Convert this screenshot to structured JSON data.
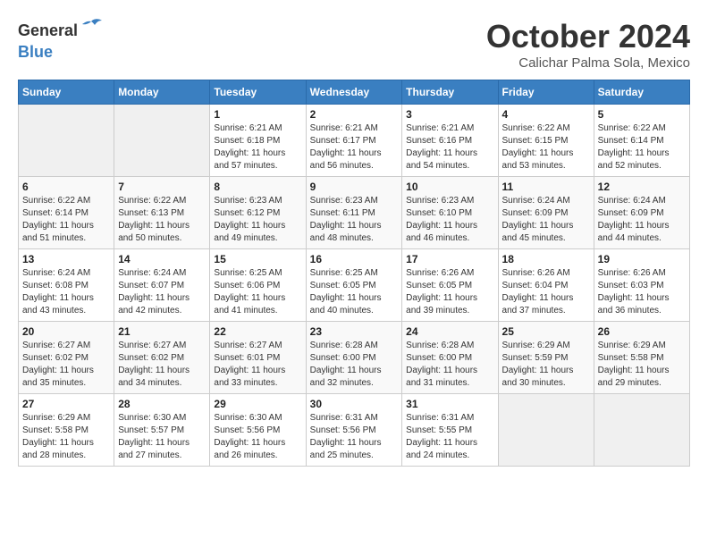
{
  "header": {
    "logo": {
      "general": "General",
      "blue": "Blue",
      "bird_symbol": "▶"
    },
    "month_title": "October 2024",
    "location": "Calichar Palma Sola, Mexico"
  },
  "calendar": {
    "weekdays": [
      "Sunday",
      "Monday",
      "Tuesday",
      "Wednesday",
      "Thursday",
      "Friday",
      "Saturday"
    ],
    "weeks": [
      [
        {
          "day": "",
          "info": ""
        },
        {
          "day": "",
          "info": ""
        },
        {
          "day": "1",
          "info": "Sunrise: 6:21 AM\nSunset: 6:18 PM\nDaylight: 11 hours and 57 minutes."
        },
        {
          "day": "2",
          "info": "Sunrise: 6:21 AM\nSunset: 6:17 PM\nDaylight: 11 hours and 56 minutes."
        },
        {
          "day": "3",
          "info": "Sunrise: 6:21 AM\nSunset: 6:16 PM\nDaylight: 11 hours and 54 minutes."
        },
        {
          "day": "4",
          "info": "Sunrise: 6:22 AM\nSunset: 6:15 PM\nDaylight: 11 hours and 53 minutes."
        },
        {
          "day": "5",
          "info": "Sunrise: 6:22 AM\nSunset: 6:14 PM\nDaylight: 11 hours and 52 minutes."
        }
      ],
      [
        {
          "day": "6",
          "info": "Sunrise: 6:22 AM\nSunset: 6:14 PM\nDaylight: 11 hours and 51 minutes."
        },
        {
          "day": "7",
          "info": "Sunrise: 6:22 AM\nSunset: 6:13 PM\nDaylight: 11 hours and 50 minutes."
        },
        {
          "day": "8",
          "info": "Sunrise: 6:23 AM\nSunset: 6:12 PM\nDaylight: 11 hours and 49 minutes."
        },
        {
          "day": "9",
          "info": "Sunrise: 6:23 AM\nSunset: 6:11 PM\nDaylight: 11 hours and 48 minutes."
        },
        {
          "day": "10",
          "info": "Sunrise: 6:23 AM\nSunset: 6:10 PM\nDaylight: 11 hours and 46 minutes."
        },
        {
          "day": "11",
          "info": "Sunrise: 6:24 AM\nSunset: 6:09 PM\nDaylight: 11 hours and 45 minutes."
        },
        {
          "day": "12",
          "info": "Sunrise: 6:24 AM\nSunset: 6:09 PM\nDaylight: 11 hours and 44 minutes."
        }
      ],
      [
        {
          "day": "13",
          "info": "Sunrise: 6:24 AM\nSunset: 6:08 PM\nDaylight: 11 hours and 43 minutes."
        },
        {
          "day": "14",
          "info": "Sunrise: 6:24 AM\nSunset: 6:07 PM\nDaylight: 11 hours and 42 minutes."
        },
        {
          "day": "15",
          "info": "Sunrise: 6:25 AM\nSunset: 6:06 PM\nDaylight: 11 hours and 41 minutes."
        },
        {
          "day": "16",
          "info": "Sunrise: 6:25 AM\nSunset: 6:05 PM\nDaylight: 11 hours and 40 minutes."
        },
        {
          "day": "17",
          "info": "Sunrise: 6:26 AM\nSunset: 6:05 PM\nDaylight: 11 hours and 39 minutes."
        },
        {
          "day": "18",
          "info": "Sunrise: 6:26 AM\nSunset: 6:04 PM\nDaylight: 11 hours and 37 minutes."
        },
        {
          "day": "19",
          "info": "Sunrise: 6:26 AM\nSunset: 6:03 PM\nDaylight: 11 hours and 36 minutes."
        }
      ],
      [
        {
          "day": "20",
          "info": "Sunrise: 6:27 AM\nSunset: 6:02 PM\nDaylight: 11 hours and 35 minutes."
        },
        {
          "day": "21",
          "info": "Sunrise: 6:27 AM\nSunset: 6:02 PM\nDaylight: 11 hours and 34 minutes."
        },
        {
          "day": "22",
          "info": "Sunrise: 6:27 AM\nSunset: 6:01 PM\nDaylight: 11 hours and 33 minutes."
        },
        {
          "day": "23",
          "info": "Sunrise: 6:28 AM\nSunset: 6:00 PM\nDaylight: 11 hours and 32 minutes."
        },
        {
          "day": "24",
          "info": "Sunrise: 6:28 AM\nSunset: 6:00 PM\nDaylight: 11 hours and 31 minutes."
        },
        {
          "day": "25",
          "info": "Sunrise: 6:29 AM\nSunset: 5:59 PM\nDaylight: 11 hours and 30 minutes."
        },
        {
          "day": "26",
          "info": "Sunrise: 6:29 AM\nSunset: 5:58 PM\nDaylight: 11 hours and 29 minutes."
        }
      ],
      [
        {
          "day": "27",
          "info": "Sunrise: 6:29 AM\nSunset: 5:58 PM\nDaylight: 11 hours and 28 minutes."
        },
        {
          "day": "28",
          "info": "Sunrise: 6:30 AM\nSunset: 5:57 PM\nDaylight: 11 hours and 27 minutes."
        },
        {
          "day": "29",
          "info": "Sunrise: 6:30 AM\nSunset: 5:56 PM\nDaylight: 11 hours and 26 minutes."
        },
        {
          "day": "30",
          "info": "Sunrise: 6:31 AM\nSunset: 5:56 PM\nDaylight: 11 hours and 25 minutes."
        },
        {
          "day": "31",
          "info": "Sunrise: 6:31 AM\nSunset: 5:55 PM\nDaylight: 11 hours and 24 minutes."
        },
        {
          "day": "",
          "info": ""
        },
        {
          "day": "",
          "info": ""
        }
      ]
    ]
  }
}
